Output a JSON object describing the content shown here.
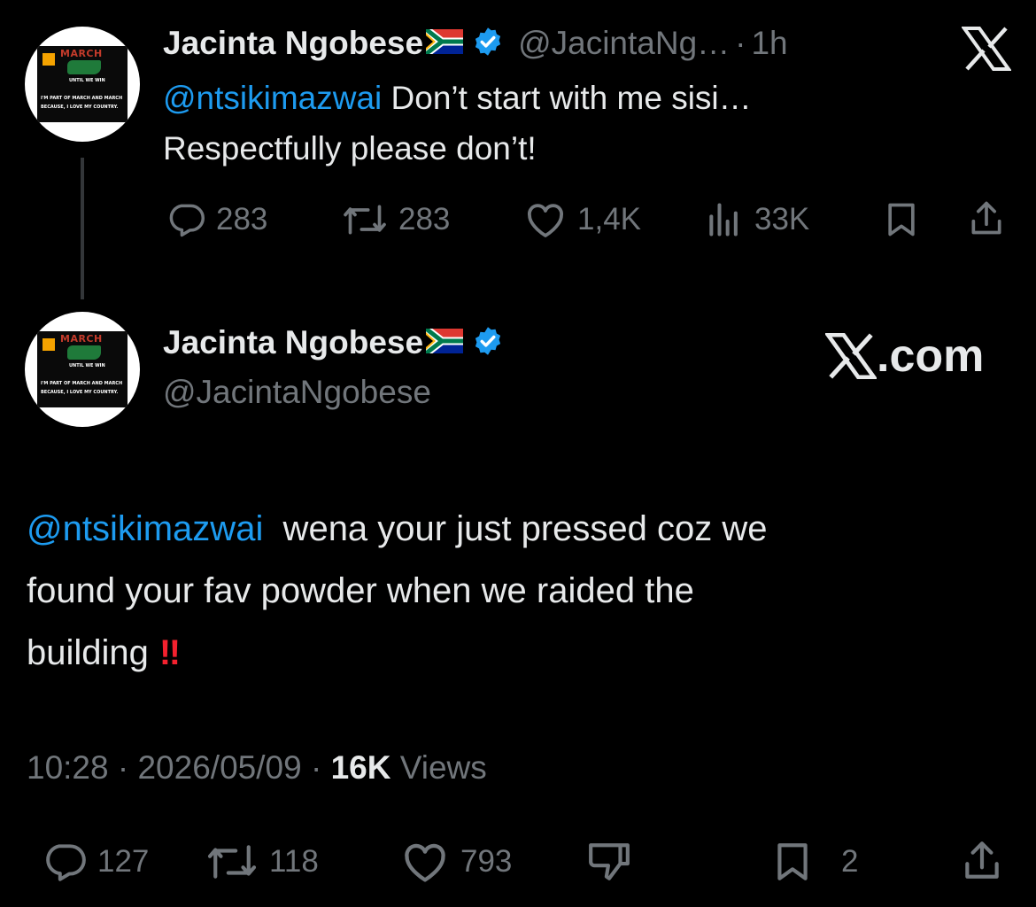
{
  "reply_tweet": {
    "author_name": "Jacinta Ngobese",
    "handle": "@JacintaNg…",
    "separator": "·",
    "age": "1h",
    "mention": "@ntsikimazwai",
    "text_line1": " Don’t start with me sisi…",
    "text_line2": "Respectfully please don’t!",
    "actions": {
      "replies": "283",
      "reposts": "283",
      "likes": "1,4K",
      "views": "33K"
    },
    "icons": [
      "comment-icon",
      "repost-icon",
      "like-icon",
      "views-icon",
      "bookmark-icon",
      "share-icon",
      "x-logo-icon"
    ]
  },
  "main_tweet": {
    "author_name": "Jacinta Ngobese",
    "handle": "@JacintaNgobese",
    "brand": ".com",
    "mention": "@ntsikimazwai",
    "text_part1": "  wena your just pressed coz we",
    "text_line2": "found your fav powder when we raided the",
    "text_line3": "building",
    "emoji": "‼",
    "time": "10:28",
    "separator": "·",
    "date": "2026/05/09",
    "views_count": "16K",
    "views_label": " Views",
    "actions": {
      "replies": "127",
      "reposts": "118",
      "likes": "793",
      "bookmarks": "2"
    }
  },
  "avatar": {
    "logo_text": "MARCH",
    "line1": "UNTIL WE WIN",
    "line2": "I'M PART OF MARCH AND MARCH",
    "line3": "BECAUSE, I LOVE MY COUNTRY."
  },
  "colors": {
    "background": "#000000",
    "text": "#e7e9ea",
    "muted": "#71767b",
    "accent": "#1d9bf0",
    "danger": "#f4212e"
  }
}
